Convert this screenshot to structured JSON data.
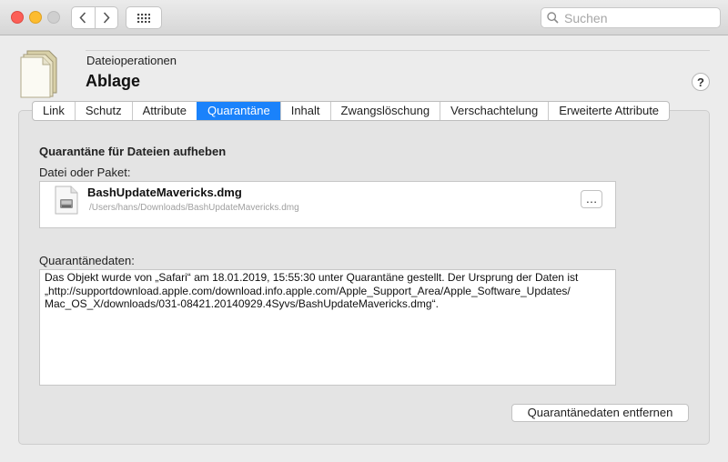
{
  "toolbar": {
    "back_icon": "chevron-left-icon",
    "forward_icon": "chevron-right-icon",
    "grid_icon": "grid-icon",
    "search_placeholder": "Suchen"
  },
  "header": {
    "subtitle": "Dateioperationen",
    "title": "Ablage",
    "help": "?"
  },
  "tabs": [
    {
      "label": "Link"
    },
    {
      "label": "Schutz"
    },
    {
      "label": "Attribute"
    },
    {
      "label": "Quarantäne",
      "active": true
    },
    {
      "label": "Inhalt"
    },
    {
      "label": "Zwangslöschung"
    },
    {
      "label": "Verschachtelung"
    },
    {
      "label": "Erweiterte Attribute"
    }
  ],
  "main": {
    "section_title": "Quarantäne für Dateien aufheben",
    "file_label": "Datei oder Paket:",
    "file_name": "BashUpdateMavericks.dmg",
    "file_path": "/Users/hans/Downloads/BashUpdateMavericks.dmg",
    "browse_label": "…",
    "quarantine_label": "Quarantänedaten:",
    "quarantine_text": "Das Objekt wurde von „Safari“ am 18.01.2019, 15:55:30 unter Quarantäne gestellt. Der Ursprung der Daten ist\n„http://supportdownload.apple.com/download.info.apple.com/Apple_Support_Area/Apple_Software_Updates/\nMac_OS_X/downloads/031-08421.20140929.4Syvs/BashUpdateMavericks.dmg“.",
    "remove_button": "Quarantänedaten entfernen"
  },
  "colors": {
    "accent": "#1a82fb",
    "close": "#fc5f57",
    "minimize": "#fdbc2e",
    "zoom_disabled": "#cfcfcf"
  }
}
